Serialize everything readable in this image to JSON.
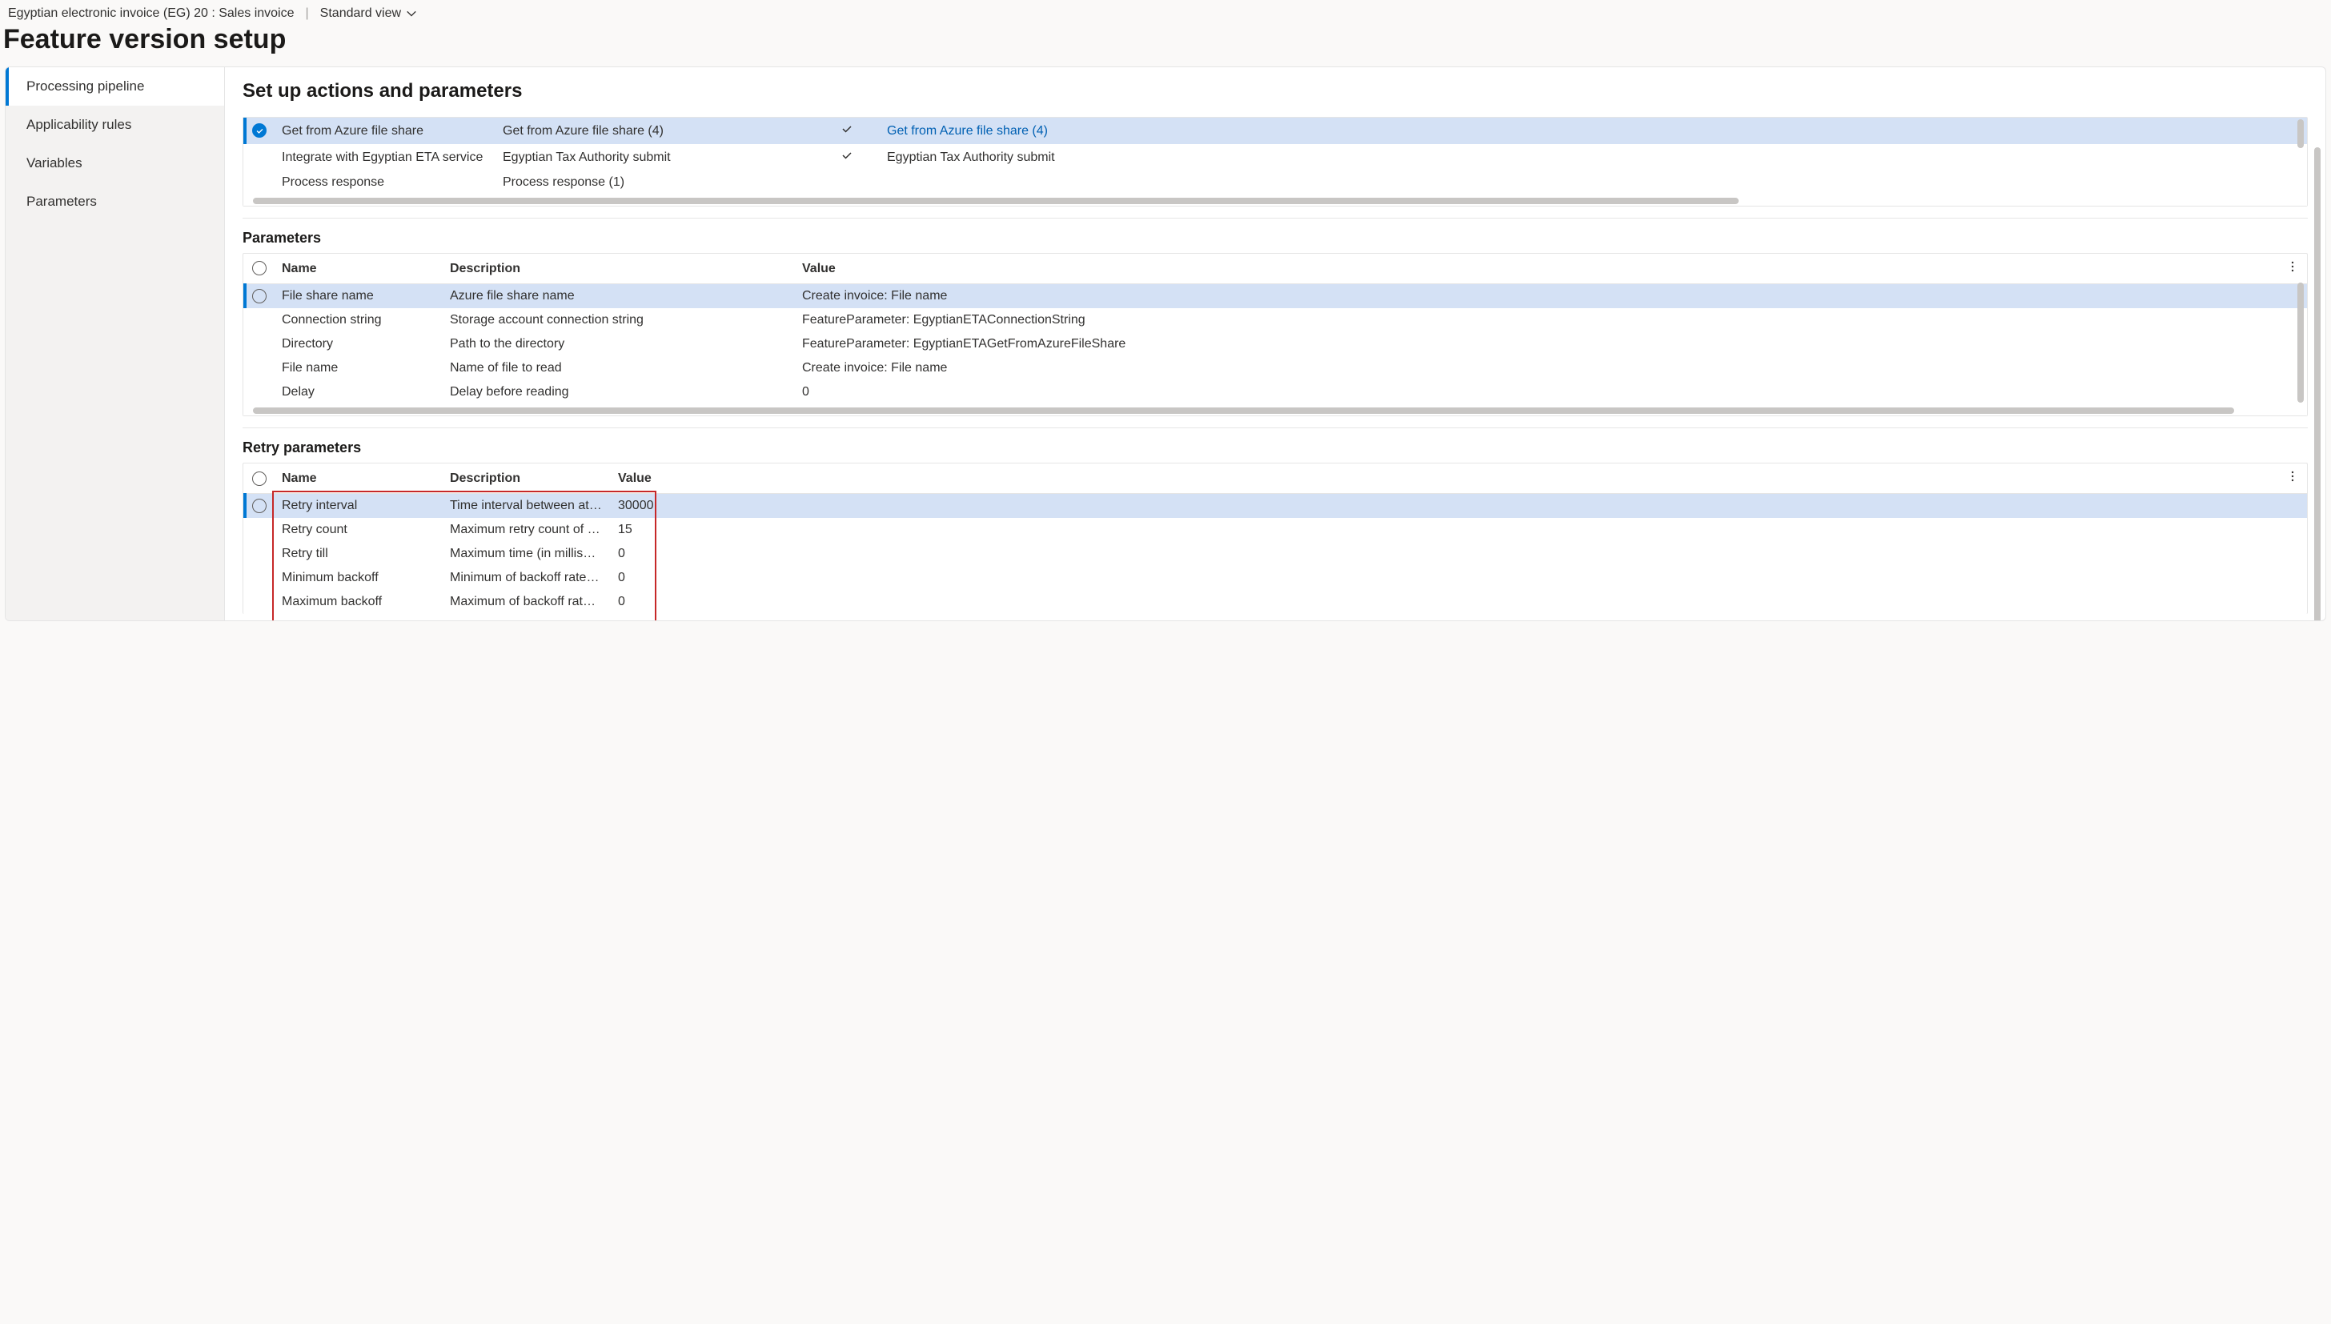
{
  "breadcrumb": "Egyptian electronic invoice (EG) 20 : Sales invoice",
  "viewSelector": "Standard view",
  "pageTitle": "Feature version setup",
  "sidebar": {
    "items": [
      {
        "label": "Processing pipeline",
        "active": true
      },
      {
        "label": "Applicability rules",
        "active": false
      },
      {
        "label": "Variables",
        "active": false
      },
      {
        "label": "Parameters",
        "active": false
      }
    ]
  },
  "sections": {
    "actions": {
      "title": "Set up actions and parameters",
      "rows": [
        {
          "selected": true,
          "name": "Get from Azure file share",
          "desc": "Get from Azure file share (4)",
          "checked": true,
          "link": "Get from Azure file share (4)"
        },
        {
          "selected": false,
          "name": "Integrate with Egyptian ETA service",
          "desc": "Egyptian Tax Authority submit",
          "checked": true,
          "link": "Egyptian Tax Authority submit"
        },
        {
          "selected": false,
          "name": "Process response",
          "desc": "Process response (1)",
          "checked": false,
          "link": ""
        }
      ]
    },
    "parameters": {
      "title": "Parameters",
      "headers": {
        "name": "Name",
        "desc": "Description",
        "value": "Value"
      },
      "rows": [
        {
          "selected": true,
          "name": "File share name",
          "desc": "Azure file share name",
          "value": "Create invoice: File name"
        },
        {
          "selected": false,
          "name": "Connection string",
          "desc": "Storage account connection string",
          "value": "FeatureParameter: EgyptianETAConnectionString"
        },
        {
          "selected": false,
          "name": "Directory",
          "desc": "Path to the directory",
          "value": "FeatureParameter: EgyptianETAGetFromAzureFileShare"
        },
        {
          "selected": false,
          "name": "File name",
          "desc": "Name of file to read",
          "value": "Create invoice: File name"
        },
        {
          "selected": false,
          "name": "Delay",
          "desc": "Delay before reading",
          "value": "0"
        }
      ]
    },
    "retry": {
      "title": "Retry parameters",
      "headers": {
        "name": "Name",
        "desc": "Description",
        "value": "Value"
      },
      "rows": [
        {
          "selected": true,
          "name": "Retry interval",
          "desc": "Time interval between att…",
          "value": "30000"
        },
        {
          "selected": false,
          "name": "Retry count",
          "desc": "Maximum retry count of a…",
          "value": "15"
        },
        {
          "selected": false,
          "name": "Retry till",
          "desc": "Maximum time (in millise…",
          "value": "0"
        },
        {
          "selected": false,
          "name": "Minimum backoff",
          "desc": "Minimum of backoff rate …",
          "value": "0"
        },
        {
          "selected": false,
          "name": "Maximum backoff",
          "desc": "Maximum of backoff rate …",
          "value": "0"
        }
      ]
    }
  }
}
